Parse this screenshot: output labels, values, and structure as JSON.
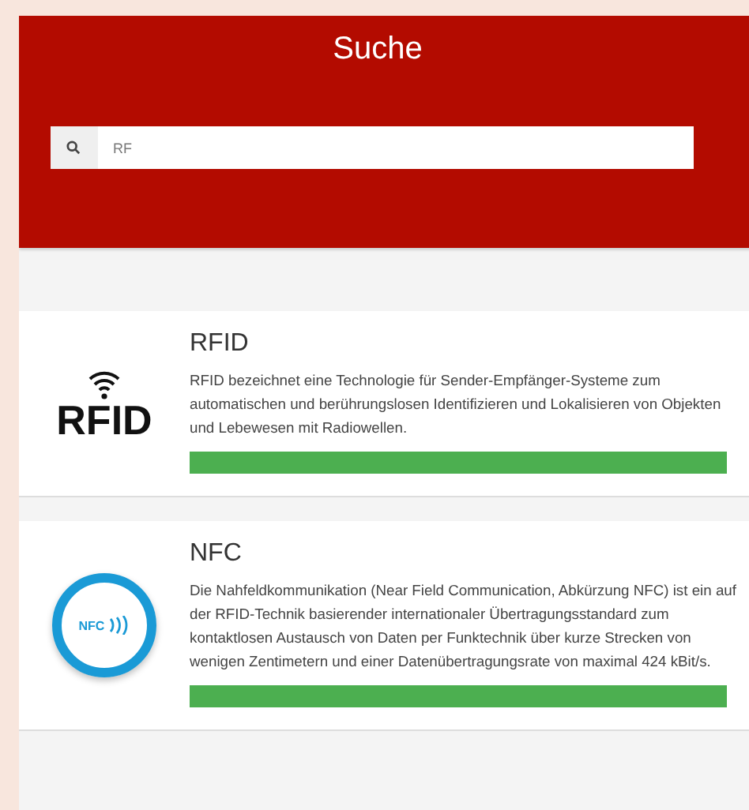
{
  "header": {
    "title": "Suche"
  },
  "search": {
    "value": "RF"
  },
  "results": [
    {
      "kind": "rfid",
      "logo_text": "RFID",
      "title": "RFID",
      "description": "RFID bezeichnet eine Technologie für Sender-Empfänger-Systeme zum automatischen und berührungslosen Identifizieren und Lokalisieren von Objekten und Lebewesen mit Radiowellen."
    },
    {
      "kind": "nfc",
      "logo_text": "NFC",
      "title": "NFC",
      "description": "Die Nahfeldkommunikation (Near Field Communication, Abkürzung NFC) ist ein auf der RFID-Technik basierender internationaler Übertragungsstandard zum kontaktlosen Austausch von Daten per Funktechnik über kurze Strecken von wenigen Zentimetern und einer Datenübertragungsrate von maximal 424 kBit/s."
    }
  ]
}
